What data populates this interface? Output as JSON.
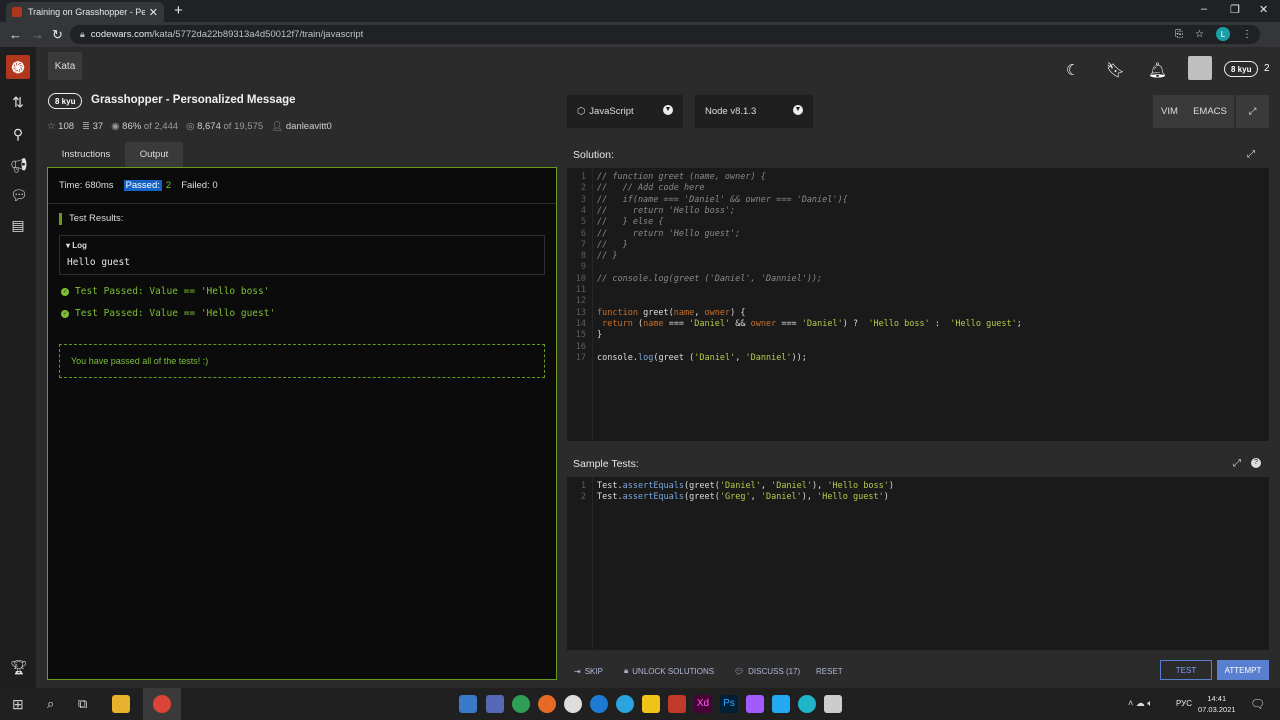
{
  "browser": {
    "tab_title": "Training on Grasshopper - Perso",
    "tab_close": "✕",
    "new_tab": "+",
    "url_host": "codewars.com",
    "url_path": "/kata/5772da22b89313a4d50012f7/train/javascript",
    "profile_initial": "L"
  },
  "header": {
    "kata_tab": "Kata",
    "user_rank": "8 kyu",
    "honor": "2"
  },
  "kata": {
    "rank": "8 kyu",
    "title": "Grasshopper - Personalized Message",
    "stars": "108",
    "collections": "37",
    "satisfaction": "86%",
    "satisfaction_of": "of 2,444",
    "completed": "8,674",
    "completed_of": "of 19,575",
    "author": "danleavitt0"
  },
  "left_tabs": [
    "Instructions",
    "Output"
  ],
  "output": {
    "time": "Time: 680ms",
    "passed_label": "Passed:",
    "passed_count": "2",
    "failed": "Failed: 0",
    "results_title": "Test Results:",
    "log_label": "Log",
    "log_value": "Hello guest",
    "tests": [
      "Test Passed: Value == 'Hello boss'",
      "Test Passed: Value == 'Hello guest'"
    ],
    "all_passed": "You have passed all of the tests! :)"
  },
  "toolbar": {
    "language": "JavaScript",
    "runtime": "Node v8.1.3",
    "vim": "VIM",
    "emacs": "EMACS"
  },
  "solution": {
    "title": "Solution:",
    "lines": [
      "// function greet (name, owner) {",
      "//   // Add code here",
      "//   if(name === 'Daniel' && owner === 'Daniel'){",
      "//     return 'Hello boss';",
      "//   } else {",
      "//     return 'Hello guest';",
      "//   }",
      "// }",
      "",
      "// console.log(greet ('Daniel', 'Danniel'));",
      "",
      "",
      "function greet(name, owner) {",
      " return (name === 'Daniel' && owner === 'Daniel') ?  'Hello boss' :  'Hello guest';",
      "}",
      "",
      "console.log(greet ('Daniel', 'Danniel'));"
    ]
  },
  "sample_tests": {
    "title": "Sample Tests:",
    "lines": [
      "Test.assertEquals(greet('Daniel', 'Daniel'), 'Hello boss')",
      "Test.assertEquals(greet('Greg', 'Daniel'), 'Hello guest')"
    ]
  },
  "actions": {
    "skip": "SKIP",
    "unlock": "UNLOCK SOLUTIONS",
    "discuss": "DISCUSS (17)",
    "reset": "RESET",
    "test": "TEST",
    "attempt": "ATTEMPT"
  },
  "taskbar": {
    "lang": "РУС",
    "time": "14:41",
    "date": "07.03.2021"
  }
}
